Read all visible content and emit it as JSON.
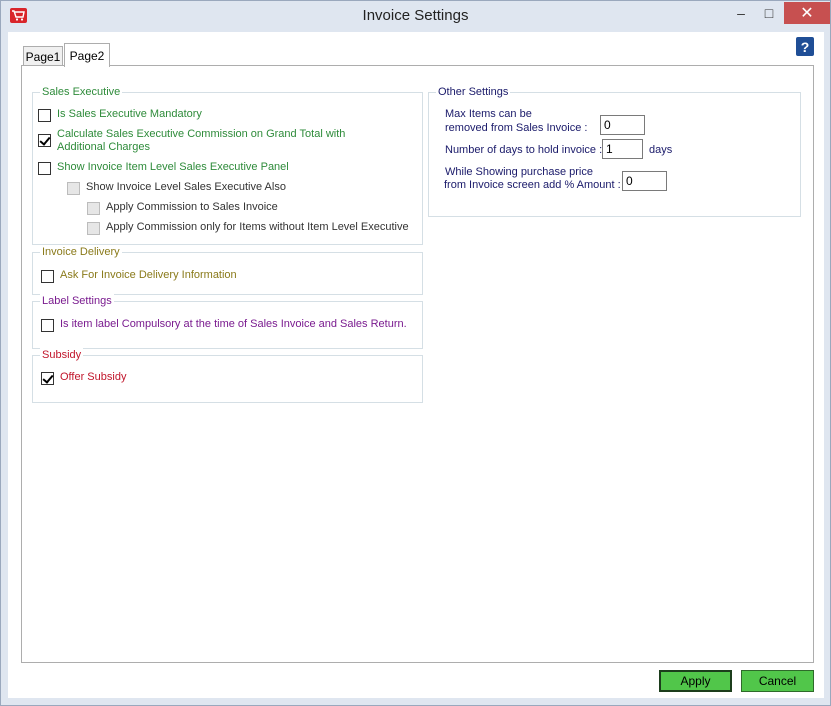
{
  "window": {
    "title": "Invoice Settings",
    "close_glyph": "✕",
    "min_glyph": "–",
    "max_glyph": "□"
  },
  "icons": {
    "app": "cart-icon",
    "help": "help-icon"
  },
  "help_label": "?",
  "tabs": [
    {
      "label": "Page1",
      "active": false
    },
    {
      "label": "Page2",
      "active": true
    }
  ],
  "sales_executive": {
    "title": "Sales Executive",
    "items": [
      {
        "label": "Is Sales Executive Mandatory",
        "checked": false,
        "enabled": true
      },
      {
        "label": "Calculate Sales Executive Commission on Grand Total with Additional Charges",
        "line1": "Calculate Sales Executive Commission on Grand Total with",
        "line2": "Additional Charges",
        "checked": true,
        "enabled": true
      },
      {
        "label": "Show Invoice Item Level Sales Executive Panel",
        "checked": false,
        "enabled": true
      },
      {
        "label": "Show Invoice Level Sales Executive Also",
        "checked": false,
        "enabled": false
      },
      {
        "label": "Apply Commission to Sales Invoice",
        "checked": false,
        "enabled": false
      },
      {
        "label": "Apply Commission only for Items without Item Level Executive",
        "checked": false,
        "enabled": false
      }
    ]
  },
  "invoice_delivery": {
    "title": "Invoice Delivery",
    "items": [
      {
        "label": "Ask For Invoice Delivery Information",
        "checked": false
      }
    ]
  },
  "label_settings": {
    "title": "Label Settings",
    "items": [
      {
        "label": "Is item label Compulsory at the time of Sales Invoice and Sales Return.",
        "checked": false
      }
    ]
  },
  "subsidy": {
    "title": "Subsidy",
    "items": [
      {
        "label": "Offer Subsidy",
        "checked": true
      }
    ]
  },
  "other_settings": {
    "title": "Other Settings",
    "max_items_line1": "Max Items can be",
    "max_items_line2": "removed from Sales Invoice :",
    "max_items_value": "0",
    "days_label": "Number of days to hold invoice :",
    "days_value": "1",
    "days_unit": "days",
    "purchase_line1": "While Showing purchase price",
    "purchase_line2": "from Invoice screen add % Amount :",
    "purchase_value": "0"
  },
  "buttons": {
    "apply": "Apply",
    "cancel": "Cancel"
  },
  "colors": {
    "sales_executive": "#2e8b3a",
    "invoice_delivery": "#8a7a1a",
    "label_settings": "#7a1b8f",
    "subsidy": "#c1152b",
    "button_green": "#51c64a"
  }
}
